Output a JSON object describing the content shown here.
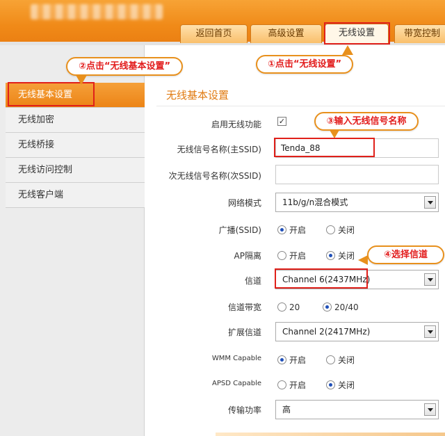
{
  "header": {
    "tabs": [
      {
        "label": "返回首页"
      },
      {
        "label": "高级设置"
      },
      {
        "label": "无线设置"
      },
      {
        "label": "带宽控制"
      }
    ]
  },
  "callouts": {
    "step1": "①点击“无线设置”",
    "step2": "②点击“无线基本设置”",
    "step3": "③输入无线信号名称",
    "step4": "④选择信道"
  },
  "sidebar": {
    "items": [
      {
        "label": "无线基本设置"
      },
      {
        "label": "无线加密"
      },
      {
        "label": "无线桥接"
      },
      {
        "label": "无线访问控制"
      },
      {
        "label": "无线客户端"
      }
    ]
  },
  "main": {
    "title": "无线基本设置",
    "enable_wireless": {
      "label": "启用无线功能",
      "checked": true
    },
    "primary_ssid": {
      "label": "无线信号名称(主SSID)",
      "value": "Tenda_88"
    },
    "secondary_ssid": {
      "label": "次无线信号名称(次SSID)",
      "value": ""
    },
    "network_mode": {
      "label": "网络模式",
      "value": "11b/g/n混合模式"
    },
    "broadcast": {
      "label": "广播(SSID)",
      "on_label": "开启",
      "off_label": "关闭",
      "selected": "on"
    },
    "ap_isolation": {
      "label": "AP隔离",
      "on_label": "开启",
      "off_label": "关闭",
      "selected": "off"
    },
    "channel": {
      "label": "信道",
      "value": "Channel 6(2437MHz)"
    },
    "bandwidth": {
      "label": "信道带宽",
      "opt1": "20",
      "opt2": "20/40",
      "selected": "20/40"
    },
    "ext_channel": {
      "label": "扩展信道",
      "value": "Channel 2(2417MHz)"
    },
    "wmm": {
      "label": "WMM Capable",
      "on_label": "开启",
      "off_label": "关闭",
      "selected": "on"
    },
    "apsd": {
      "label": "APSD Capable",
      "on_label": "开启",
      "off_label": "关闭",
      "selected": "off"
    },
    "tx_power": {
      "label": "传输功率",
      "value": "高"
    }
  },
  "colors": {
    "header_orange": "#f08a18",
    "title_orange": "#e07a10",
    "highlight_red": "#e0201a",
    "callout_text": "#e21c1c"
  }
}
